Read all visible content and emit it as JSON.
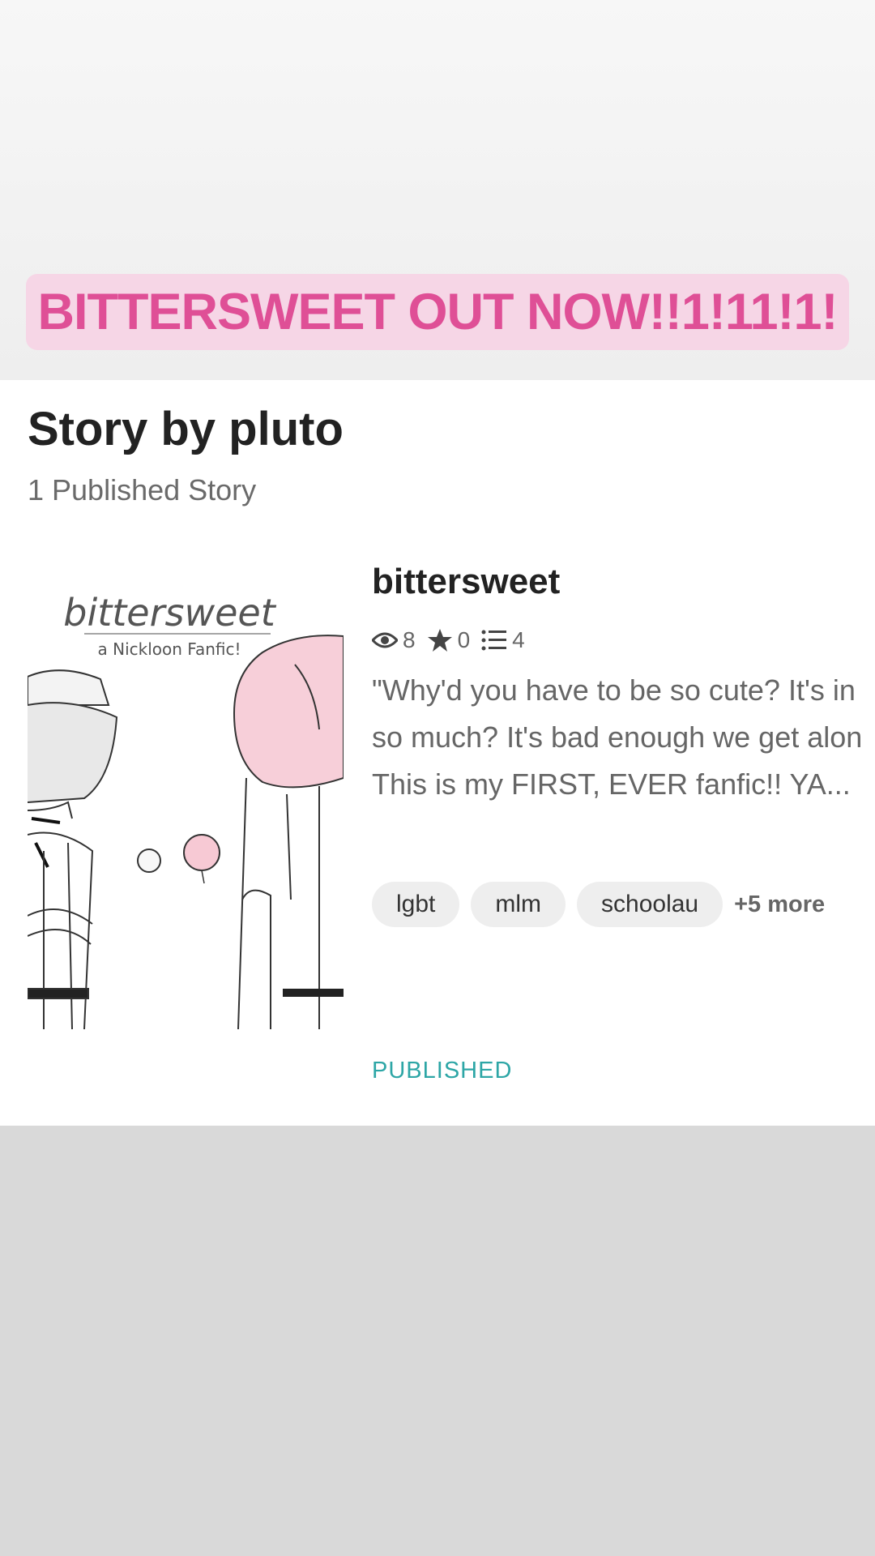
{
  "banner": {
    "text": "BITTERSWEET OUT NOW!!1!11!1!"
  },
  "profile": {
    "heading": "Story by pluto",
    "count_label": "1 Published Story"
  },
  "story": {
    "cover_title": "bittersweet",
    "cover_subtitle": "a Nickloon Fanfic!",
    "title": "bittersweet",
    "stats": {
      "views": "8",
      "votes": "0",
      "parts": "4"
    },
    "description_lines": [
      "\"Why'd you have to be so cute? It's in",
      "so much? It's bad enough we get alon",
      "This is my FIRST, EVER fanfic!! YA..."
    ],
    "tags": [
      "lgbt",
      "mlm",
      "schoolau"
    ],
    "more_tags": "+5 more",
    "status": "PUBLISHED"
  },
  "colors": {
    "banner_bg": "#f6d6e6",
    "banner_text": "#df4f96",
    "status": "#2da6a6",
    "lower_bg": "#d9d9d9"
  },
  "icons": [
    "eye-icon",
    "star-icon",
    "list-icon"
  ]
}
